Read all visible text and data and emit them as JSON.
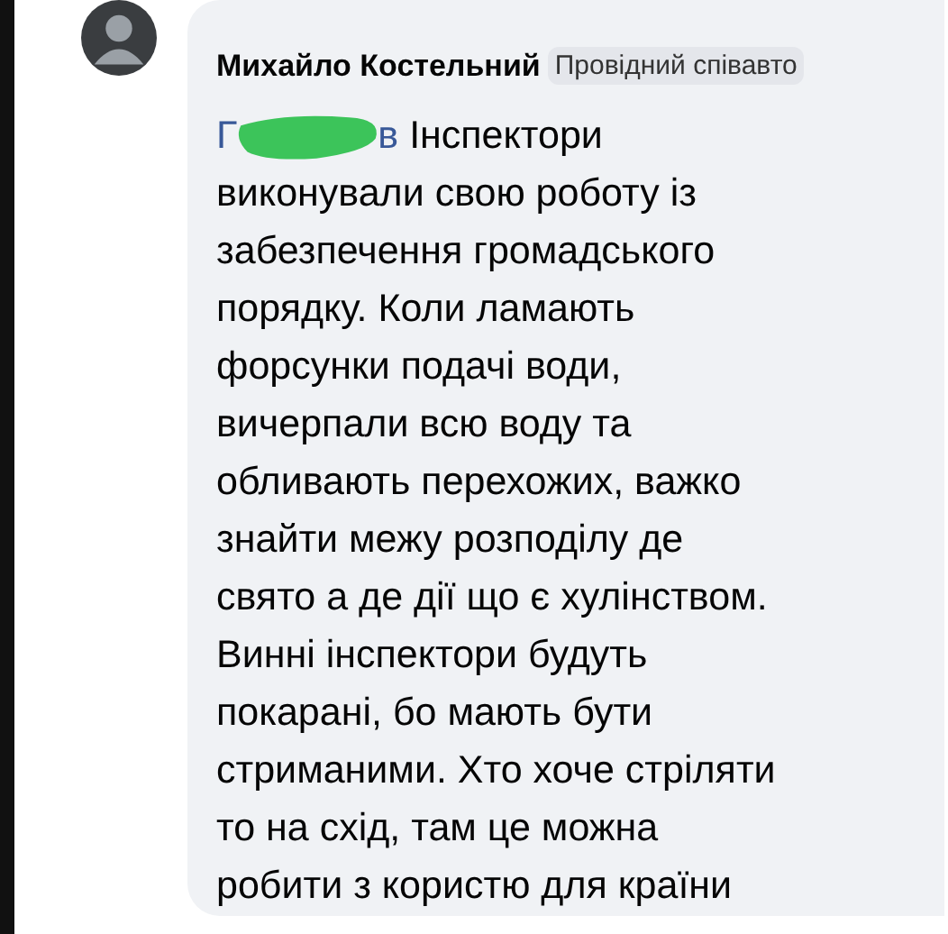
{
  "comment": {
    "author": "Михайло Костельний",
    "badge": "Провідний співавто",
    "mention_visible": [
      "Г",
      "в"
    ],
    "mention_redacted": true,
    "lines": [
      "Інспектори",
      "виконували свою роботу із",
      "забезпечення громадського",
      "порядку. Коли ламають",
      "форсунки подачі води,",
      "вичерпали всю воду та",
      "обливають перехожих, важко",
      "знайти межу розподілу де",
      "свято а де дії що є хулінством.",
      "Винні інспектори будуть",
      "покарані, бо мають бути",
      "стриманими. Хто хоче стріляти",
      "то на схід, там це можна",
      "робити з користю для країни"
    ]
  }
}
